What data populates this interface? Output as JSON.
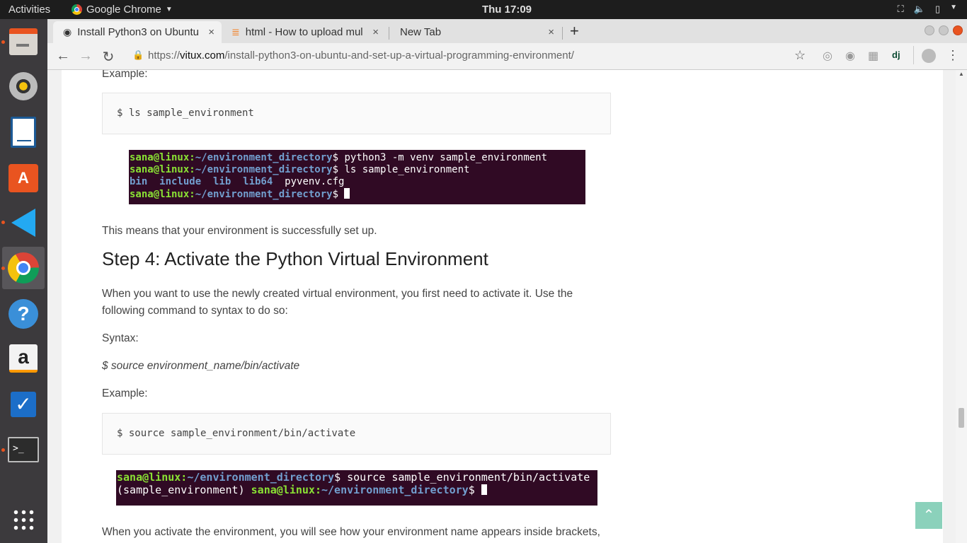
{
  "topbar": {
    "activities": "Activities",
    "app_name": "Google Chrome",
    "clock": "Thu 17:09"
  },
  "dock": {
    "apps": [
      "file-cabinet-icon",
      "rhythmbox-icon",
      "writer-icon",
      "software-center-icon",
      "vscode-icon",
      "chrome-icon",
      "help-icon",
      "amazon-icon",
      "todo-icon",
      "terminal-icon",
      "app-grid-icon"
    ]
  },
  "tabs": [
    {
      "title": "Install Python3 on Ubuntu",
      "close": "×"
    },
    {
      "title": "html - How to upload mul",
      "close": "×"
    },
    {
      "title": "New Tab",
      "close": "×"
    }
  ],
  "new_tab": "+",
  "address": {
    "scheme": "https://",
    "host": "vitux.com",
    "path": "/install-python3-on-ubuntu-and-set-up-a-virtual-programming-environment/"
  },
  "ext_dj": "dj",
  "article": {
    "example1_label": "Example:",
    "code1": "$ ls sample_environment",
    "term1": {
      "line1_user": "sana@linux:",
      "line1_path": "~/environment_directory",
      "line1_cmd": "$ python3 -m venv sample_environment",
      "line2_user": "sana@linux:",
      "line2_path": "~/environment_directory",
      "line2_cmd": "$ ls sample_environment",
      "line3_dirs": "bin  include  lib  lib64",
      "line3_file": "  pyvenv.cfg",
      "line4_user": "sana@linux:",
      "line4_path": "~/environment_directory",
      "line4_cmd": "$ "
    },
    "success_text": "This means that your environment is successfully set up.",
    "step4_heading": "Step 4: Activate the Python Virtual Environment",
    "step4_intro": "When you want to use the newly created virtual environment, you first need to activate it. Use the following command to syntax to do so:",
    "syntax_label": "Syntax:",
    "syntax_text": "$ source environment_name/bin/activate",
    "example2_label": "Example:",
    "code2": "$ source sample_environment/bin/activate",
    "term2": {
      "line1_user": "sana@linux:",
      "line1_path": "~/environment_directory",
      "line1_cmd": "$ source sample_environment/bin/activate",
      "line2_env": "(sample_environment) ",
      "line2_user": "sana@linux:",
      "line2_path": "~/environment_directory",
      "line2_cmd": "$ "
    },
    "bottom_text": "When you activate the environment, you will see how your environment name appears inside brackets,"
  },
  "back_to_top": "⌃"
}
